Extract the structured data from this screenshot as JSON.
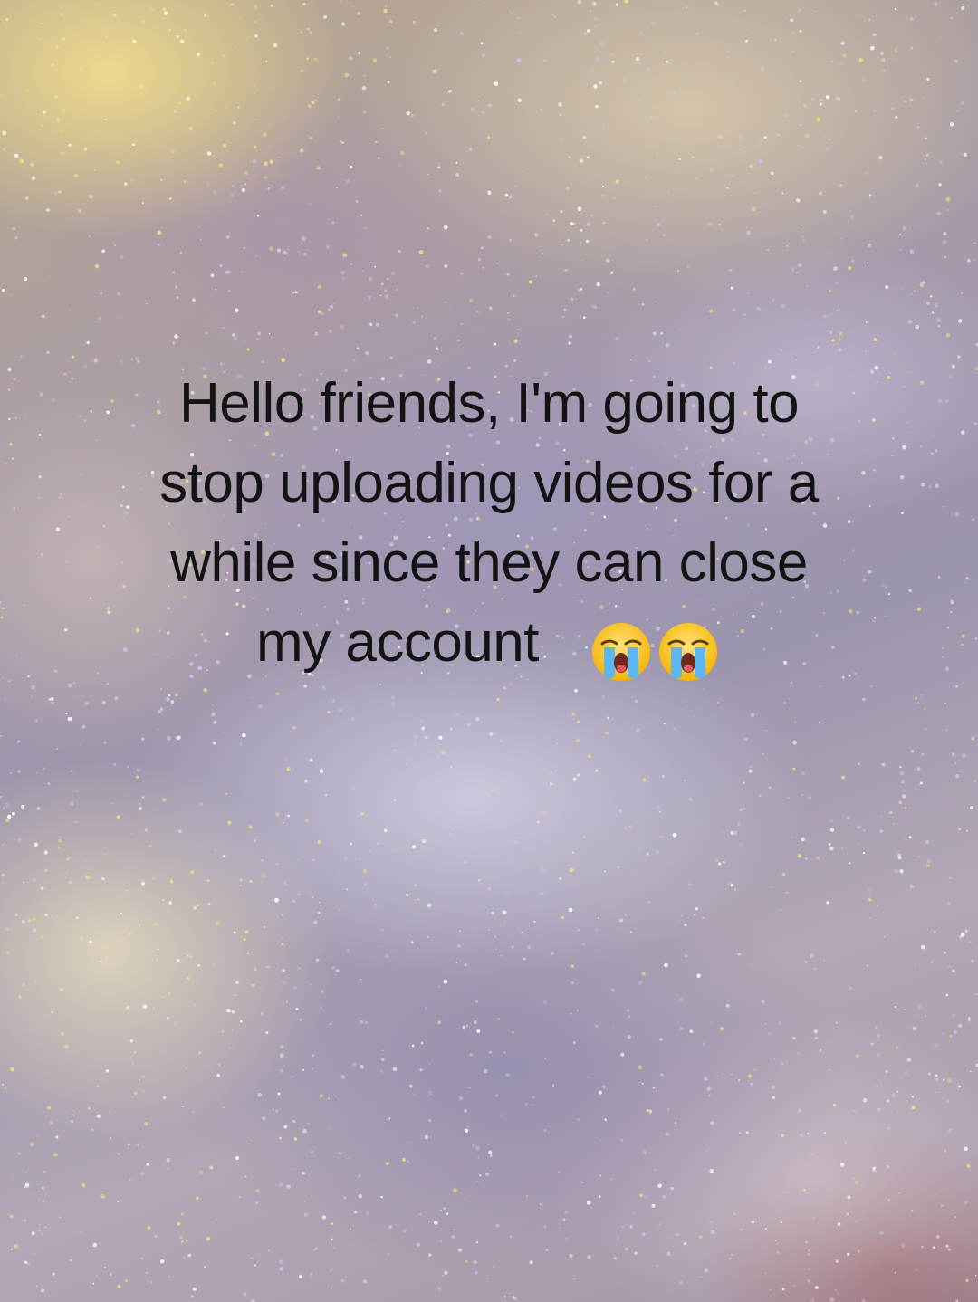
{
  "caption": {
    "line1": "Hello friends, I'm going to",
    "line2": "stop uploading videos for a",
    "line3": "while since they can close",
    "line4": "my account"
  },
  "emojis": [
    "loudly-crying-face",
    "loudly-crying-face"
  ],
  "colors": {
    "caption_text": "#141414",
    "glitter_gold": "#f3dc8a",
    "glitter_lavender": "#c9c3e6"
  }
}
